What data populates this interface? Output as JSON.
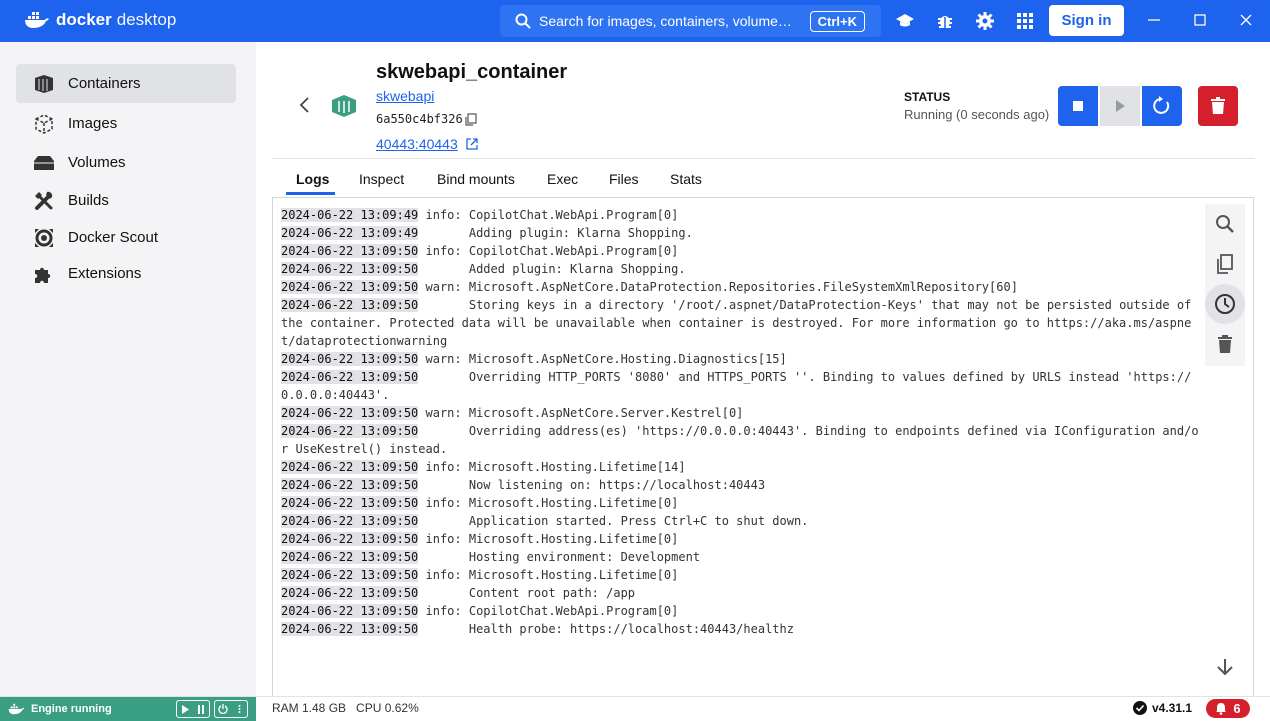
{
  "app": {
    "brand_bold": "docker",
    "brand_light": "desktop"
  },
  "search": {
    "placeholder": "Search for images, containers, volume…",
    "shortcut": "Ctrl+K"
  },
  "topbar": {
    "signin_label": "Sign in"
  },
  "sidebar": {
    "items": [
      {
        "label": "Containers",
        "icon": "containers-icon",
        "active": true
      },
      {
        "label": "Images",
        "icon": "images-icon"
      },
      {
        "label": "Volumes",
        "icon": "volumes-icon"
      },
      {
        "label": "Builds",
        "icon": "builds-icon"
      },
      {
        "label": "Docker Scout",
        "icon": "docker-scout-icon"
      },
      {
        "label": "Extensions",
        "icon": "extensions-icon"
      }
    ]
  },
  "container": {
    "name": "skwebapi_container",
    "image": "skwebapi",
    "id": "6a550c4bf326",
    "port": "40443:40443",
    "status_label": "STATUS",
    "status_value": "Running (0 seconds ago)"
  },
  "tabs": [
    "Logs",
    "Inspect",
    "Bind mounts",
    "Exec",
    "Files",
    "Stats"
  ],
  "logs": [
    {
      "ts": "2024-06-22 13:09:49",
      "msg": " info: CopilotChat.WebApi.Program[0]"
    },
    {
      "ts": "2024-06-22 13:09:49",
      "msg": "       Adding plugin: Klarna Shopping."
    },
    {
      "ts": "2024-06-22 13:09:50",
      "msg": " info: CopilotChat.WebApi.Program[0]"
    },
    {
      "ts": "2024-06-22 13:09:50",
      "msg": "       Added plugin: Klarna Shopping."
    },
    {
      "ts": "2024-06-22 13:09:50",
      "msg": " warn: Microsoft.AspNetCore.DataProtection.Repositories.FileSystemXmlRepository[60]"
    },
    {
      "ts": "2024-06-22 13:09:50",
      "msg": "       Storing keys in a directory '/root/.aspnet/DataProtection-Keys' that may not be persisted outside of the container. Protected data will be unavailable when container is destroyed. For more information go to https://aka.ms/aspnet/dataprotectionwarning"
    },
    {
      "ts": "2024-06-22 13:09:50",
      "msg": " warn: Microsoft.AspNetCore.Hosting.Diagnostics[15]"
    },
    {
      "ts": "2024-06-22 13:09:50",
      "msg": "       Overriding HTTP_PORTS '8080' and HTTPS_PORTS ''. Binding to values defined by URLS instead 'https://0.0.0.0:40443'."
    },
    {
      "ts": "2024-06-22 13:09:50",
      "msg": " warn: Microsoft.AspNetCore.Server.Kestrel[0]"
    },
    {
      "ts": "2024-06-22 13:09:50",
      "msg": "       Overriding address(es) 'https://0.0.0.0:40443'. Binding to endpoints defined via IConfiguration and/or UseKestrel() instead."
    },
    {
      "ts": "2024-06-22 13:09:50",
      "msg": " info: Microsoft.Hosting.Lifetime[14]"
    },
    {
      "ts": "2024-06-22 13:09:50",
      "msg": "       Now listening on: https://localhost:40443"
    },
    {
      "ts": "2024-06-22 13:09:50",
      "msg": " info: Microsoft.Hosting.Lifetime[0]"
    },
    {
      "ts": "2024-06-22 13:09:50",
      "msg": "       Application started. Press Ctrl+C to shut down."
    },
    {
      "ts": "2024-06-22 13:09:50",
      "msg": " info: Microsoft.Hosting.Lifetime[0]"
    },
    {
      "ts": "2024-06-22 13:09:50",
      "msg": "       Hosting environment: Development"
    },
    {
      "ts": "2024-06-22 13:09:50",
      "msg": " info: Microsoft.Hosting.Lifetime[0]"
    },
    {
      "ts": "2024-06-22 13:09:50",
      "msg": "       Content root path: /app"
    },
    {
      "ts": "2024-06-22 13:09:50",
      "msg": " info: CopilotChat.WebApi.Program[0]"
    },
    {
      "ts": "2024-06-22 13:09:50",
      "msg": "       Health probe: https://localhost:40443/healthz"
    }
  ],
  "footer": {
    "engine_status": "Engine running",
    "ram": "RAM 1.48 GB",
    "cpu": "CPU 0.62%",
    "version": "v4.31.1",
    "notifications": "6"
  },
  "colors": {
    "brand": "#1d63ed",
    "engine": "#3a9e83",
    "danger": "#d4202c"
  }
}
